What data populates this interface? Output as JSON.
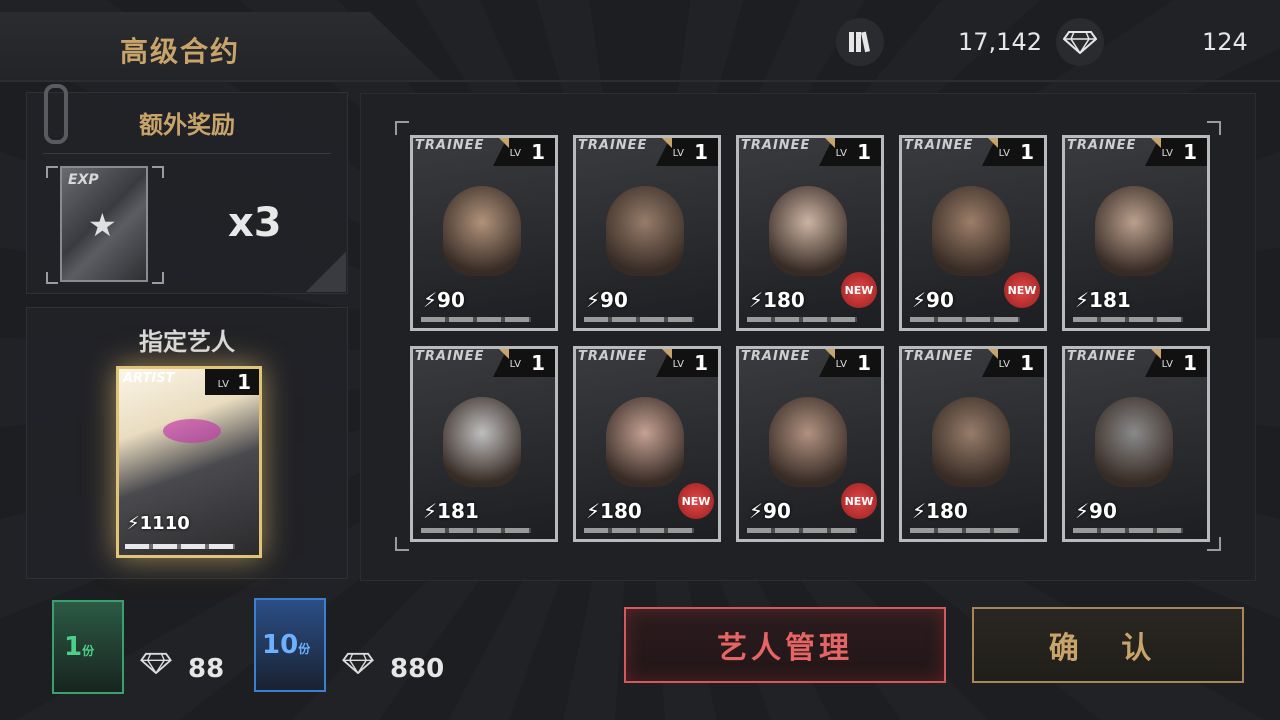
{
  "header": {
    "title": "高级合约",
    "currency1": {
      "icon": "cards-icon",
      "value": "17,142"
    },
    "currency2": {
      "icon": "diamond-icon",
      "value": "124"
    }
  },
  "bonus": {
    "title": "额外奖励",
    "card_label": "EXP",
    "multiplier": "x3"
  },
  "designated": {
    "title": "指定艺人",
    "card": {
      "tag": "ARTIST",
      "lv_label": "LV",
      "level": "1",
      "power": "1110"
    }
  },
  "cards": [
    {
      "tag": "TRAINEE",
      "lv_label": "LV",
      "level": "1",
      "power": "90",
      "new": false
    },
    {
      "tag": "TRAINEE",
      "lv_label": "LV",
      "level": "1",
      "power": "90",
      "new": false
    },
    {
      "tag": "TRAINEE",
      "lv_label": "LV",
      "level": "1",
      "power": "180",
      "new": true,
      "new_label": "NEW"
    },
    {
      "tag": "TRAINEE",
      "lv_label": "LV",
      "level": "1",
      "power": "90",
      "new": true,
      "new_label": "NEW"
    },
    {
      "tag": "TRAINEE",
      "lv_label": "LV",
      "level": "1",
      "power": "181",
      "new": false
    },
    {
      "tag": "TRAINEE",
      "lv_label": "LV",
      "level": "1",
      "power": "181",
      "new": false
    },
    {
      "tag": "TRAINEE",
      "lv_label": "LV",
      "level": "1",
      "power": "180",
      "new": true,
      "new_label": "NEW"
    },
    {
      "tag": "TRAINEE",
      "lv_label": "LV",
      "level": "1",
      "power": "90",
      "new": true,
      "new_label": "NEW"
    },
    {
      "tag": "TRAINEE",
      "lv_label": "LV",
      "level": "1",
      "power": "180",
      "new": false
    },
    {
      "tag": "TRAINEE",
      "lv_label": "LV",
      "level": "1",
      "power": "90",
      "new": false
    }
  ],
  "packs": [
    {
      "qty": "1",
      "unit": "份",
      "price": "88",
      "color": "#3aa070"
    },
    {
      "qty": "10",
      "unit": "份",
      "price": "880",
      "color": "#3b7fd0"
    }
  ],
  "buttons": {
    "manage": "艺人管理",
    "confirm": "确 认"
  }
}
